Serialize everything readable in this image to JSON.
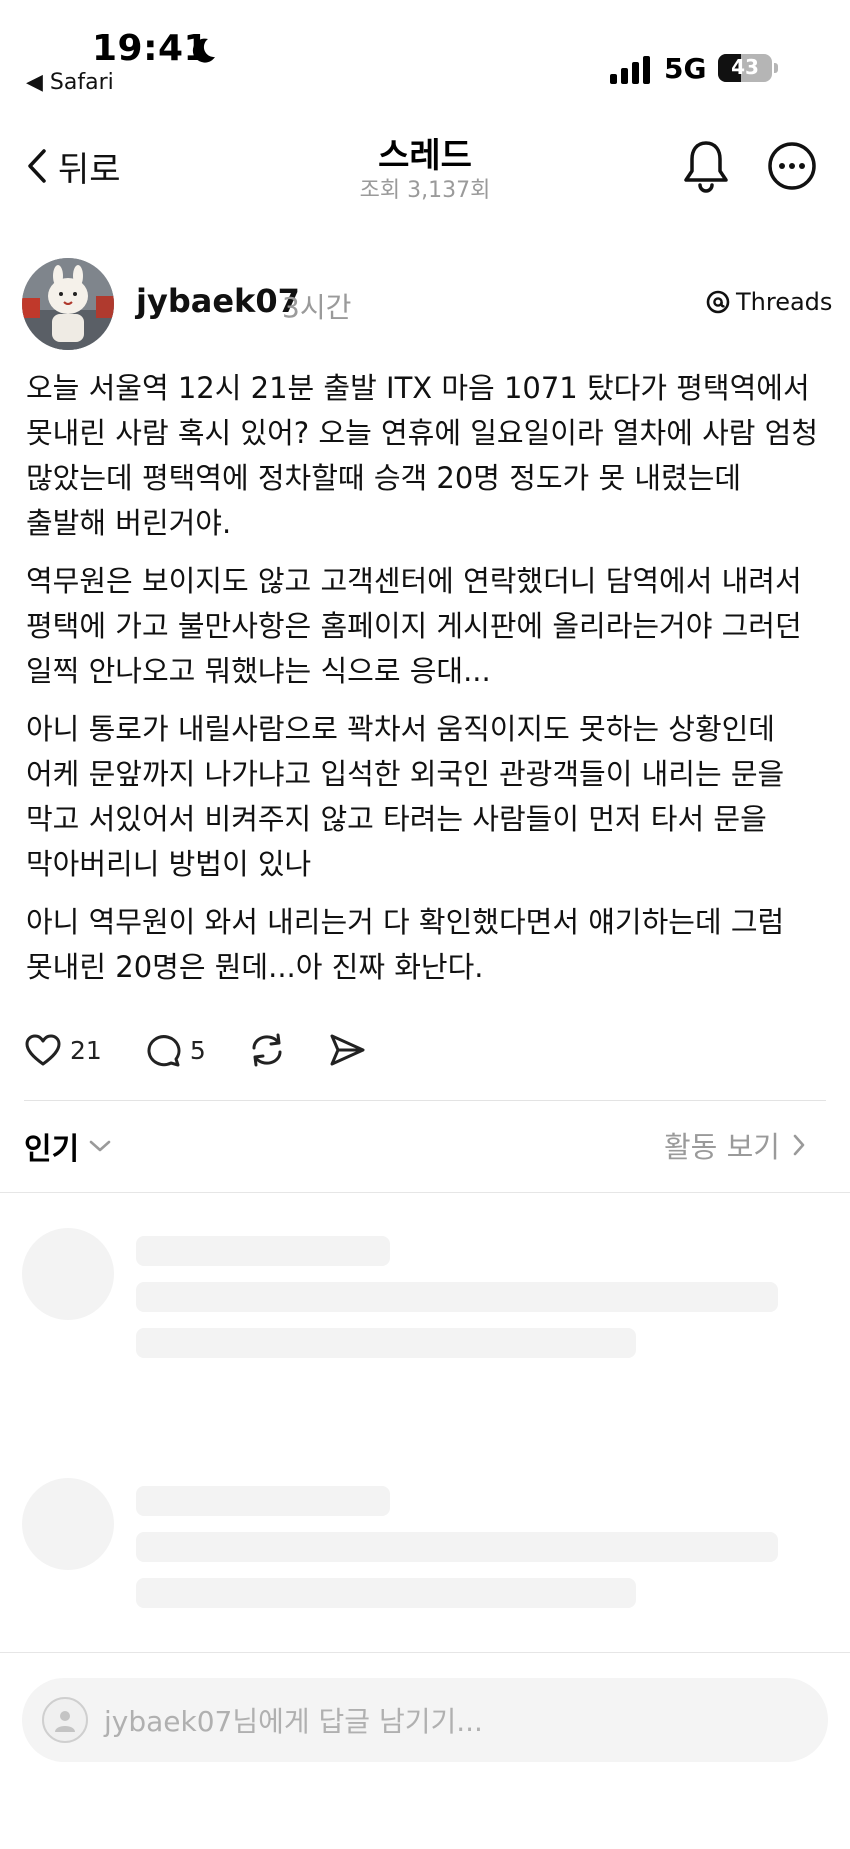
{
  "status_bar": {
    "time": "19:41",
    "back_app": "◀ Safari",
    "network": "5G",
    "battery": "43",
    "battery_level": 0.43
  },
  "nav": {
    "back_label": "뒤로",
    "title": "스레드",
    "views": "조회 3,137회"
  },
  "post": {
    "username": "jybaek07",
    "time": "3시간",
    "badge": "Threads",
    "paragraphs": [
      "오늘 서울역 12시 21분 출발 ITX 마음 1071 탔다가 평택역에서 못내린 사람 혹시 있어? 오늘 연휴에 일요일이라 열차에 사람 엄청 많았는데 평택역에 정차할때 승객 20명 정도가 못 내렸는데 출발해 버린거야.",
      "역무원은 보이지도 않고 고객센터에 연락했더니 담역에서 내려서 평택에 가고 불만사항은 홈페이지 게시판에 올리라는거야 그러던 일찍 안나오고 뭐했냐는 식으로 응대...",
      "아니 통로가 내릴사람으로 꽉차서 움직이지도 못하는 상황인데 어케 문앞까지 나가냐고 입석한 외국인 관광객들이 내리는 문을 막고 서있어서 비켜주지 않고 타려는 사람들이 먼저 타서 문을 막아버리니 방법이 있나",
      "아니 역무원이 와서 내리는거 다 확인했다면서 얘기하는데 그럼 못내린 20명은 뭔데...아 진짜 화난다."
    ],
    "likes": "21",
    "comments": "5"
  },
  "replies_header": {
    "sort_label": "인기",
    "activity_label": "활동 보기"
  },
  "composer": {
    "placeholder": "jybaek07님에게 답글 남기기..."
  },
  "colors": {
    "text": "#111111",
    "muted": "#9a9a9a",
    "skeleton": "#f3f3f3",
    "divider": "#e3e3e3"
  },
  "icons": [
    "moon-icon",
    "signal-icon",
    "chevron-left-icon",
    "bell-icon",
    "more-icon",
    "threads-logo-icon",
    "heart-icon",
    "comment-icon",
    "repost-icon",
    "send-icon",
    "chevron-down-icon",
    "chevron-right-icon",
    "user-icon"
  ]
}
